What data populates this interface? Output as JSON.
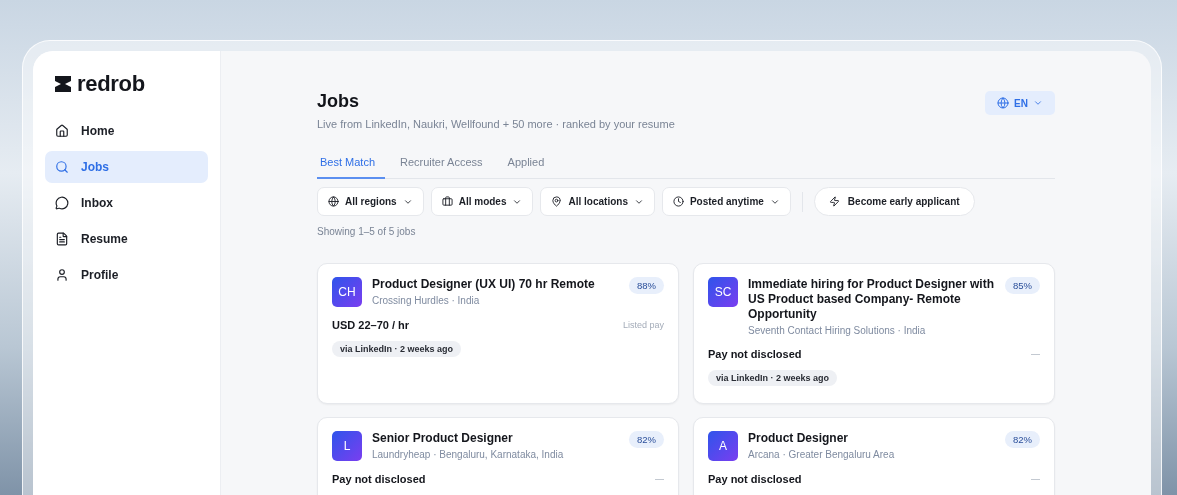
{
  "brand": {
    "name": "redrob"
  },
  "sidebar": {
    "items": [
      {
        "label": "Home",
        "selected": false
      },
      {
        "label": "Jobs",
        "selected": true
      },
      {
        "label": "Inbox",
        "selected": false
      },
      {
        "label": "Resume",
        "selected": false
      },
      {
        "label": "Profile",
        "selected": false
      }
    ]
  },
  "header": {
    "title": "Jobs",
    "subtitle": "Live from LinkedIn, Naukri, Wellfound + 50 more · ranked by your resume",
    "language": "EN"
  },
  "tabs": [
    {
      "label": "Best Match",
      "selected": true
    },
    {
      "label": "Recruiter Access",
      "selected": false
    },
    {
      "label": "Applied",
      "selected": false
    }
  ],
  "filters": [
    {
      "label": "All regions"
    },
    {
      "label": "All modes"
    },
    {
      "label": "All locations"
    },
    {
      "label": "Posted anytime"
    }
  ],
  "early_button": {
    "label": "Become early applicant"
  },
  "result_count": "Showing 1–5 of 5 jobs",
  "jobs": [
    {
      "initials": "CH",
      "title": "Product Designer (UX UI) 70 hr Remote",
      "company": "Crossing Hurdles · India",
      "match": "88%",
      "pay": "USD 22–70 / hr",
      "pay_note": "Listed pay",
      "source": "via LinkedIn · 2 weeks ago"
    },
    {
      "initials": "SC",
      "title": "Immediate hiring for Product Designer with US Product based Company- Remote Opportunity",
      "company": "Seventh Contact Hiring Solutions · India",
      "match": "85%",
      "pay": "Pay not disclosed",
      "pay_note": "—",
      "source": "via LinkedIn · 2 weeks ago"
    },
    {
      "initials": "L",
      "title": "Senior Product Designer",
      "company": "Laundryheap · Bengaluru, Karnataka, India",
      "match": "82%",
      "pay": "Pay not disclosed",
      "pay_note": "—"
    },
    {
      "initials": "A",
      "title": "Product Designer",
      "company": "Arcana · Greater Bengaluru Area",
      "match": "82%",
      "pay": "Pay not disclosed",
      "pay_note": "—"
    }
  ]
}
